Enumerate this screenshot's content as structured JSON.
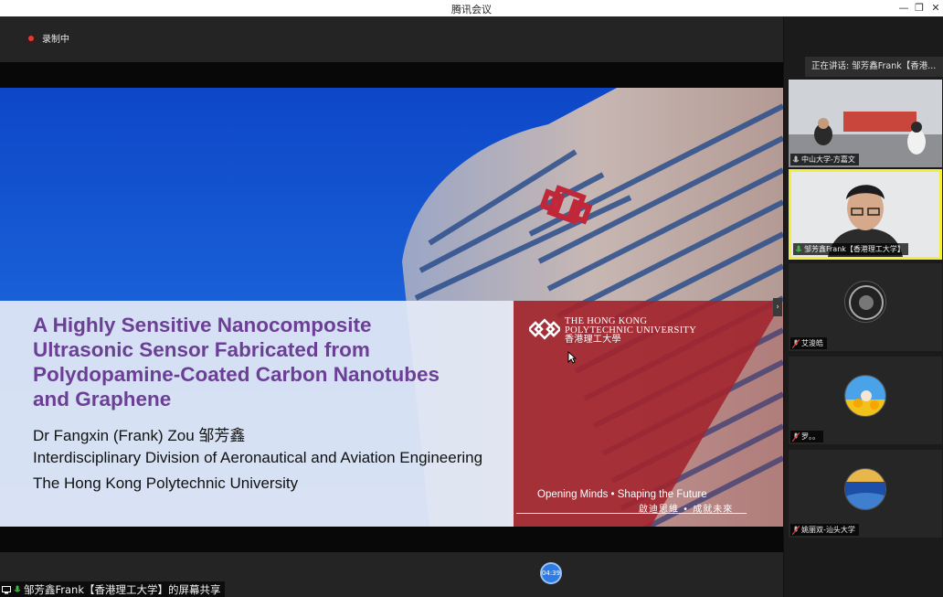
{
  "window": {
    "title": "腾讯会议",
    "minimize": "—",
    "restore": "❐",
    "close": "✕"
  },
  "recording": {
    "label": "录制中"
  },
  "slide": {
    "title_lines": [
      "A Highly Sensitive Nanocomposite",
      "Ultrasonic Sensor Fabricated from",
      "Polydopamine-Coated Carbon Nanotubes",
      "and Graphene"
    ],
    "author": "Dr Fangxin (Frank) Zou 邹芳鑫",
    "department": "Interdisciplinary Division of Aeronautical and Aviation Engineering",
    "university": "The Hong Kong Polytechnic University",
    "logo_lines": [
      "THE HONG KONG",
      "POLYTECHNIC UNIVERSITY",
      "香港理工大學"
    ],
    "motto_en": "Opening Minds • Shaping the Future",
    "motto_zh": "啟迪思維 • 成就未來",
    "colors": {
      "title": "#6b3f95",
      "red_panel": "#a3262e"
    }
  },
  "share": {
    "label": "邹芳鑫Frank【香港理工大学】的屏幕共享"
  },
  "timer": {
    "label": "04:39"
  },
  "sidebar": {
    "speaking": "正在讲话: 邹芳鑫Frank【香港...",
    "participants": [
      {
        "name": "中山大学-方嘉文",
        "active": false,
        "type": "video"
      },
      {
        "name": "邹芳鑫Frank【香港理工大学】",
        "active": true,
        "type": "video"
      },
      {
        "name": "艾浚皓",
        "active": false,
        "type": "avatar"
      },
      {
        "name": "罗。。",
        "active": false,
        "type": "avatar"
      },
      {
        "name": "姚丽双-汕头大学",
        "active": false,
        "type": "avatar"
      }
    ]
  }
}
